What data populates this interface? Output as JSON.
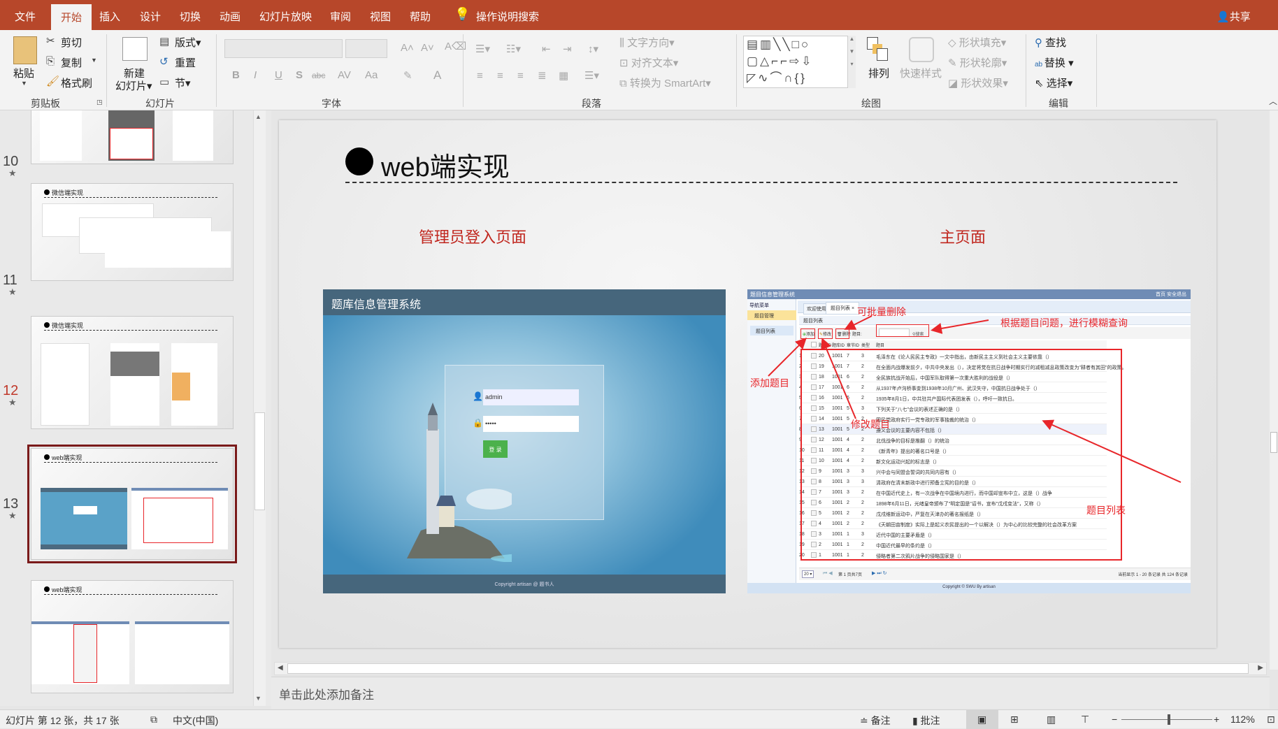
{
  "tabs": [
    "文件",
    "开始",
    "插入",
    "设计",
    "切换",
    "动画",
    "幻灯片放映",
    "审阅",
    "视图",
    "帮助"
  ],
  "active_tab": "开始",
  "tell_me": "操作说明搜索",
  "share": "共享",
  "ribbon": {
    "clipboard": {
      "label": "剪贴板",
      "paste": "粘贴",
      "cut": "剪切",
      "copy": "复制",
      "format_painter": "格式刷"
    },
    "slides": {
      "label": "幻灯片",
      "new_slide_1": "新建",
      "new_slide_2": "幻灯片",
      "layout": "版式",
      "reset": "重置",
      "section": "节"
    },
    "font": {
      "label": "字体",
      "bold": "B",
      "italic": "I",
      "underline": "U",
      "shadow": "S",
      "strike": "abc",
      "spacing": "AV",
      "case": "Aa",
      "color": "A"
    },
    "paragraph": {
      "label": "段落",
      "text_direction": "文字方向",
      "align_text": "对齐文本",
      "smartart": "转换为 SmartArt"
    },
    "drawing": {
      "label": "绘图",
      "arrange": "排列",
      "quick_styles": "快速样式",
      "fill": "形状填充",
      "outline": "形状轮廓",
      "effects": "形状效果"
    },
    "editing": {
      "label": "编辑",
      "find": "查找",
      "replace": "替换",
      "select": "选择"
    }
  },
  "thumbnails": [
    {
      "num": "",
      "title": ""
    },
    {
      "num": "10",
      "title": "微信端实现"
    },
    {
      "num": "11",
      "title": "微信端实现"
    },
    {
      "num": "12",
      "title": "web端实现",
      "selected": true
    },
    {
      "num": "13",
      "title": "web端实现"
    }
  ],
  "slide": {
    "title": "web端实现",
    "left_caption": "管理员登入页面",
    "right_caption": "主页面",
    "login": {
      "header": "题库信息管理系统",
      "username": "admin",
      "password": "•••••",
      "login_button": "登 录",
      "footer": "Copyright  artisan @ 题书人"
    },
    "main": {
      "header": "题目信息管理系统",
      "header_links": "首页  安全退出",
      "nav_title": "导航菜单",
      "nav_group": "题目管理",
      "nav_item": "题目列表",
      "tabs": [
        "欢迎使用",
        "题目列表 ×"
      ],
      "panel_title": "题目列表",
      "toolbar": {
        "add": "添加",
        "edit": "修改",
        "delete": "删除",
        "search_label": "题目:",
        "search_button": "搜索"
      },
      "columns": [
        "题目ID",
        "题库ID",
        "章节ID",
        "类型",
        "题目"
      ],
      "rows": [
        [
          "1",
          "20",
          "1001",
          "7",
          "3",
          "毛泽东在《论人民民主专政》一文中指出，由新民主主义到社会主义主要依靠（）"
        ],
        [
          "2",
          "19",
          "1001",
          "7",
          "2",
          "在全面内战爆发前夕，中共中央发出（），决定将党在抗日战争时期实行的减租减息政策改变为\"耕者有其田\"的政策。"
        ],
        [
          "3",
          "18",
          "1001",
          "6",
          "2",
          "全民族抗战开始后，中国军队取得第一次重大胜利的战役是（）"
        ],
        [
          "4",
          "17",
          "1001",
          "6",
          "2",
          "从1937年卢沟桥事变到1938年10月广州、武汉失守，中国抗日战争处于（）"
        ],
        [
          "5",
          "16",
          "1001",
          "6",
          "2",
          "1935年8月1日，中共驻共产国际代表团发表（），呼吁一致抗日。"
        ],
        [
          "6",
          "15",
          "1001",
          "5",
          "3",
          "下列关于\"八七\"会议的表述正确的是（）"
        ],
        [
          "7",
          "14",
          "1001",
          "5",
          "2",
          "国民党政府实行一党专政的军事独裁的统治（）"
        ],
        [
          "8",
          "13",
          "1001",
          "5",
          "2",
          "遵义会议的主要内容不包括（）"
        ],
        [
          "9",
          "12",
          "1001",
          "4",
          "2",
          "北伐战争的目标是推翻（）的统治"
        ],
        [
          "10",
          "11",
          "1001",
          "4",
          "2",
          "《新青年》提出的著名口号是（）"
        ],
        [
          "11",
          "10",
          "1001",
          "4",
          "2",
          "新文化运动兴起的标志是（）"
        ],
        [
          "12",
          "9",
          "1001",
          "3",
          "3",
          "兴中会与同盟会誓词的共同内容有（）"
        ],
        [
          "13",
          "8",
          "1001",
          "3",
          "3",
          "清政府在清末新政中进行预备立宪的目的是（）"
        ],
        [
          "14",
          "7",
          "1001",
          "3",
          "2",
          "在中国近代史上，有一次战争在中国境内进行，而中国却宣布中立，这是（）战争"
        ],
        [
          "15",
          "6",
          "1001",
          "2",
          "2",
          "1898年6月11日，光绪皇帝颁布了\"明定国是\"诏书，宣布\"戊戌变法\"，又称（）"
        ],
        [
          "16",
          "5",
          "1001",
          "2",
          "2",
          "戊戌维新运动中，严复在天津办的著名报纸是（）"
        ],
        [
          "17",
          "4",
          "1001",
          "2",
          "2",
          "《天朝田亩制度》实际上是起义农民提出的一个以解决（）为中心的比较完整的社会改革方案"
        ],
        [
          "18",
          "3",
          "1001",
          "1",
          "3",
          "近代中国的主要矛盾是（）"
        ],
        [
          "19",
          "2",
          "1001",
          "1",
          "2",
          "中国近代最早的条约是（）"
        ],
        [
          "20",
          "1",
          "1001",
          "1",
          "2",
          "侵略者第二次鸦片战争的侵略国家是（）"
        ]
      ],
      "pager": {
        "page_size": "20 ▾",
        "page_text": "第 1 页共7页",
        "summary": "当前显示 1 - 20 条记录 共 124 条记录"
      },
      "footer": "Copyright © SWU By artisan"
    },
    "annotations": {
      "batch_delete": "可批量删除",
      "fuzzy_search": "根据题目问题，进行模糊查询",
      "add_question": "添加题目",
      "edit_question": "修改题目",
      "question_list": "题目列表"
    }
  },
  "notes_placeholder": "单击此处添加备注",
  "status": {
    "slide_info": "幻灯片 第 12 张，共 17 张",
    "language": "中文(中国)",
    "notes": "备注",
    "comments": "批注",
    "zoom": "112%",
    "zoom_level_percent": 112
  },
  "colors": {
    "brand": "#b7472a",
    "annotation": "#e8262a",
    "selected_thumb": "#7a1a1a"
  }
}
